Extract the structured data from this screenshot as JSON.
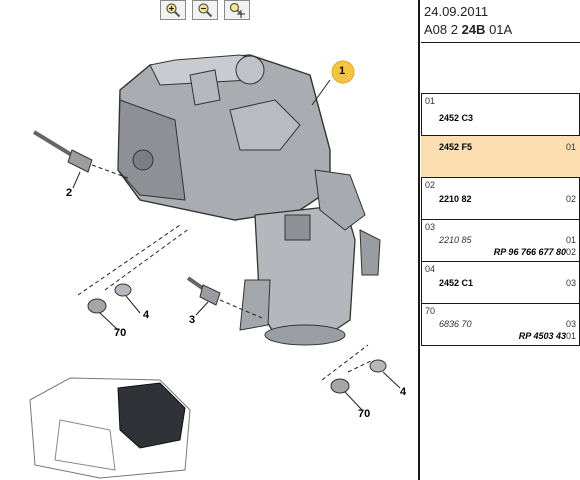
{
  "toolbar": {
    "zoom_in": "zoom-in",
    "zoom_out": "zoom-out",
    "pan": "zoom-pan"
  },
  "header": {
    "date": "24.09.2011",
    "ref_prefix": "A08 2 ",
    "ref_bold": "24B",
    "ref_suffix": " 01A"
  },
  "diagram": {
    "callouts": {
      "c1": "1",
      "c2": "2",
      "c3": "3",
      "c4a": "4",
      "c4b": "4",
      "c70a": "70",
      "c70b": "70"
    }
  },
  "parts": [
    {
      "code": "01",
      "ref": "2452 C3",
      "qty": "",
      "rp": "",
      "italic": false
    },
    {
      "code": "",
      "ref": "2452 F5",
      "qty": "01",
      "rp": "",
      "italic": false
    },
    {
      "code": "02",
      "ref": "2210 82",
      "qty": "02",
      "rp": "",
      "italic": false
    },
    {
      "code": "03",
      "ref": "2210 85",
      "qty": "01",
      "rp": "RP 96 766 677 80",
      "qty2": "02",
      "italic": true
    },
    {
      "code": "04",
      "ref": "2452 C1",
      "qty": "03",
      "rp": "",
      "italic": false
    },
    {
      "code": "70",
      "ref": "6836 70",
      "qty": "03",
      "rp": "RP 4503 43",
      "qty2": "01",
      "italic": true
    }
  ],
  "colors": {
    "highlight": "#fcdfb1",
    "callout_marker": "#f5c542"
  }
}
